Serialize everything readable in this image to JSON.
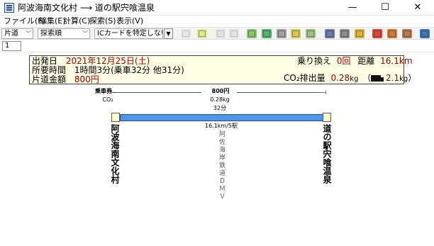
{
  "window": {
    "title": "阿波海南文化村 ⟶ 道の駅宍喰温泉",
    "minimize": "—",
    "maximize": "☐",
    "close": "✕"
  },
  "menu": [
    {
      "label": "ファイル(F)"
    },
    {
      "label": "編集(E)"
    },
    {
      "label": "計算(C)"
    },
    {
      "label": "探索(S)"
    },
    {
      "label": "表示(V)"
    }
  ],
  "toolbar": {
    "trip_type": "片道",
    "sort_order": "探索順",
    "ic_card": "ICカードを特定しない",
    "combo_arrow": "▼",
    "icons": [
      "table-icon",
      "map-icon",
      "edit-disabled-icon",
      "ex-disabled-icon",
      "route-icon",
      "timetable-icon",
      "pass-icon",
      "zoom-icon",
      "settings-icon",
      "print-icon",
      "bus-icon",
      "back-icon",
      "forward-icon",
      "stop-icon",
      "help-icon"
    ]
  },
  "page": {
    "value": "1"
  },
  "summary": {
    "dep_label": "出発日",
    "dep_value": "2021年12月25日(土)",
    "time_label": "所要時間",
    "time_value": "1時間3分(乗車32分 他31分)",
    "fare_label": "片道金額",
    "fare_value": "800円",
    "transfers_label": "乗り換え",
    "transfers_value": "0回",
    "distance_label": "距離",
    "distance_value": "16.1km",
    "co2_label": "CO₂排出量",
    "co2_value": "0.28",
    "co2_unit": "kg",
    "truck_value": "2.1",
    "truck_unit": "kg"
  },
  "route": {
    "ticket_label": "乗車券",
    "fare": "800円",
    "co2_label": "CO₂",
    "co2_value": "0.28kg",
    "ride_time": "32分",
    "distance": "16.1km/5駅",
    "origin": "阿波海南文化村",
    "destination": "道の駅宍喰温泉",
    "line_name": "阿佐海岸鉄道ＤＭＶ",
    "bar_color": "#4f95ea"
  }
}
